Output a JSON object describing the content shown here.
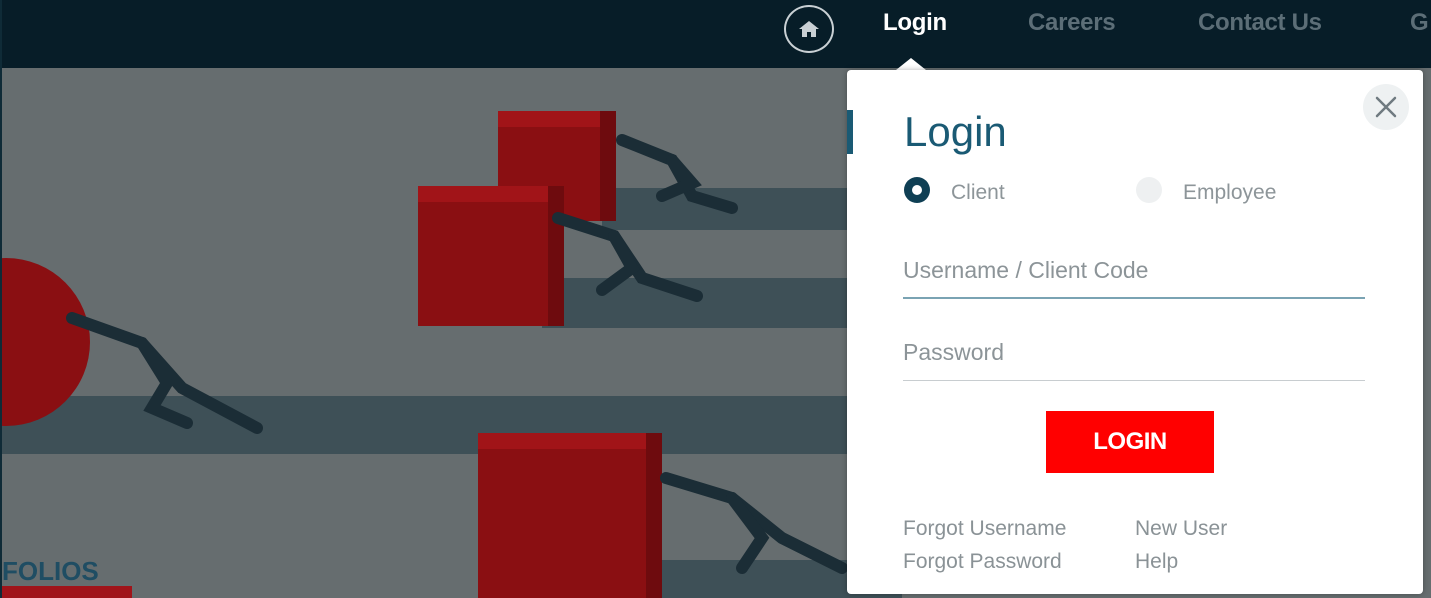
{
  "nav": {
    "items": [
      {
        "label": "Login",
        "active": true
      },
      {
        "label": "Careers",
        "active": false
      },
      {
        "label": "Contact Us",
        "active": false
      },
      {
        "label": "G",
        "active": false
      }
    ],
    "home_icon": "home-icon"
  },
  "hero": {
    "partial_text": "FOLIOS"
  },
  "login_popup": {
    "title": "Login",
    "close_icon": "close-icon",
    "user_types": [
      {
        "label": "Client",
        "selected": true
      },
      {
        "label": "Employee",
        "selected": false
      }
    ],
    "username": {
      "value": "",
      "placeholder": "Username / Client Code"
    },
    "password": {
      "value": "",
      "placeholder": "Password"
    },
    "submit_label": "LOGIN",
    "links": {
      "forgot_username": "Forgot Username",
      "forgot_password": "Forgot Password",
      "new_user": "New User",
      "help": "Help"
    }
  },
  "colors": {
    "nav_bg": "#071d28",
    "accent": "#1a5a74",
    "button": "#ff0000",
    "hero_bg": "#666d6f"
  }
}
